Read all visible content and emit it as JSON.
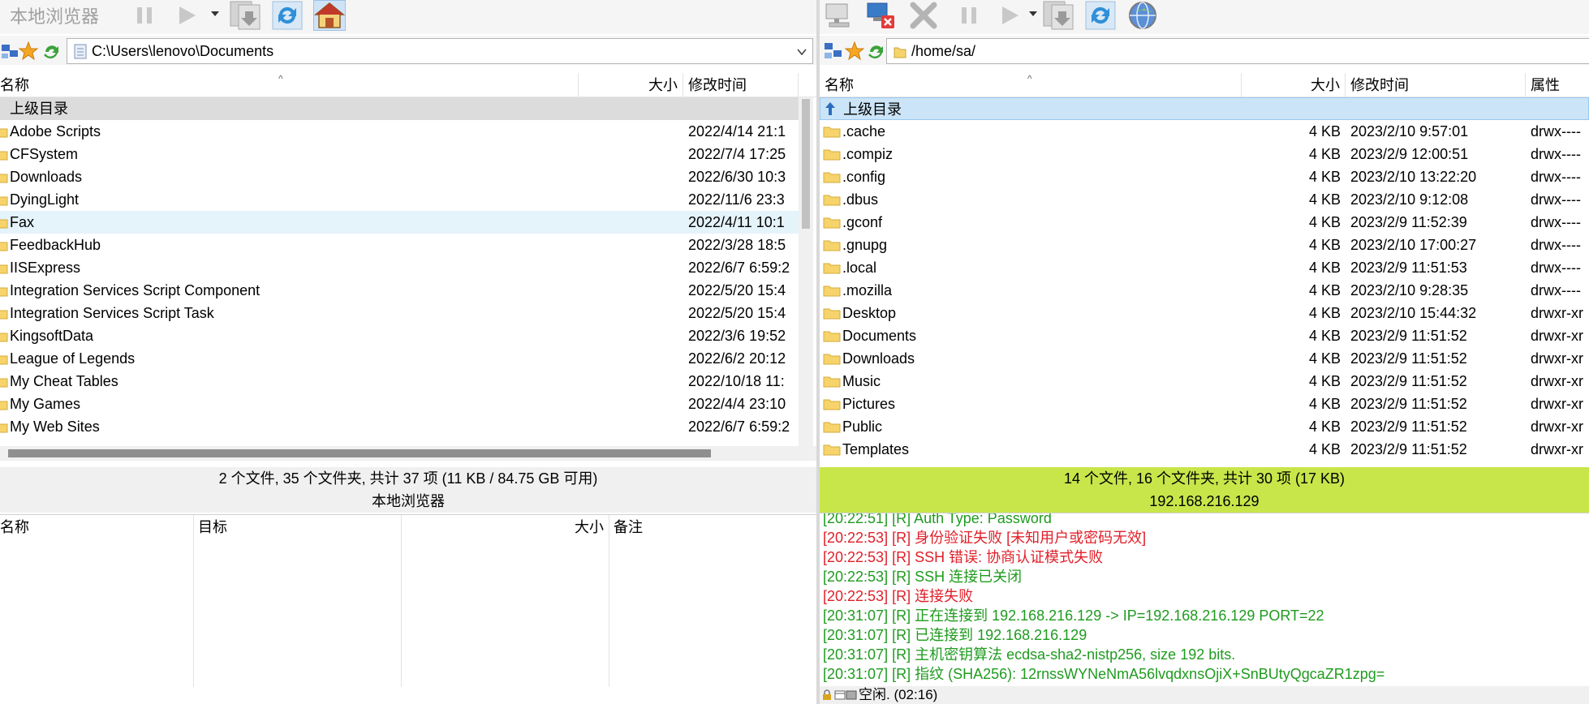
{
  "left": {
    "toolbar": {
      "title": "本地浏览器"
    },
    "address": {
      "path": "C:\\Users\\lenovo\\Documents"
    },
    "columns": {
      "name": "名称",
      "size": "大小",
      "modified": "修改时间"
    },
    "parent_row": {
      "name": "上级目录"
    },
    "rows": [
      {
        "name": "Adobe Scripts",
        "size": "",
        "modified": "2022/4/14 21:1"
      },
      {
        "name": "CFSystem",
        "size": "",
        "modified": "2022/7/4 17:25"
      },
      {
        "name": "Downloads",
        "size": "",
        "modified": "2022/6/30 10:3"
      },
      {
        "name": "DyingLight",
        "size": "",
        "modified": "2022/11/6 23:3"
      },
      {
        "name": "Fax",
        "size": "",
        "modified": "2022/4/11 10:1"
      },
      {
        "name": "FeedbackHub",
        "size": "",
        "modified": "2022/3/28 18:5"
      },
      {
        "name": "IISExpress",
        "size": "",
        "modified": "2022/6/7 6:59:2"
      },
      {
        "name": "Integration Services Script Component",
        "size": "",
        "modified": "2022/5/20 15:4"
      },
      {
        "name": "Integration Services Script Task",
        "size": "",
        "modified": "2022/5/20 15:4"
      },
      {
        "name": "KingsoftData",
        "size": "",
        "modified": "2022/3/6 19:52"
      },
      {
        "name": "League of Legends",
        "size": "",
        "modified": "2022/6/2 20:12"
      },
      {
        "name": "My Cheat Tables",
        "size": "",
        "modified": "2022/10/18 11:"
      },
      {
        "name": "My Games",
        "size": "",
        "modified": "2022/4/4 23:10"
      },
      {
        "name": "My Web Sites",
        "size": "",
        "modified": "2022/6/7 6:59:2"
      }
    ],
    "status": "2 个文件, 35 个文件夹, 共计 37 项 (11 KB / 84.75 GB 可用)",
    "substatus": "本地浏览器"
  },
  "queue": {
    "columns": {
      "name": "名称",
      "target": "目标",
      "size": "大小",
      "note": "备注"
    }
  },
  "right": {
    "address": {
      "path": "/home/sa/"
    },
    "columns": {
      "name": "名称",
      "size": "大小",
      "modified": "修改时间",
      "attrs": "属性"
    },
    "parent_row": {
      "name": "上级目录"
    },
    "rows": [
      {
        "name": ".cache",
        "size": "4 KB",
        "modified": "2023/2/10 9:57:01",
        "attrs": "drwx----"
      },
      {
        "name": ".compiz",
        "size": "4 KB",
        "modified": "2023/2/9 12:00:51",
        "attrs": "drwx----"
      },
      {
        "name": ".config",
        "size": "4 KB",
        "modified": "2023/2/10 13:22:20",
        "attrs": "drwx----"
      },
      {
        "name": ".dbus",
        "size": "4 KB",
        "modified": "2023/2/10 9:12:08",
        "attrs": "drwx----"
      },
      {
        "name": ".gconf",
        "size": "4 KB",
        "modified": "2023/2/9 11:52:39",
        "attrs": "drwx----"
      },
      {
        "name": ".gnupg",
        "size": "4 KB",
        "modified": "2023/2/10 17:00:27",
        "attrs": "drwx----"
      },
      {
        "name": ".local",
        "size": "4 KB",
        "modified": "2023/2/9 11:51:53",
        "attrs": "drwx----"
      },
      {
        "name": ".mozilla",
        "size": "4 KB",
        "modified": "2023/2/10 9:28:35",
        "attrs": "drwx----"
      },
      {
        "name": "Desktop",
        "size": "4 KB",
        "modified": "2023/2/10 15:44:32",
        "attrs": "drwxr-xr"
      },
      {
        "name": "Documents",
        "size": "4 KB",
        "modified": "2023/2/9 11:51:52",
        "attrs": "drwxr-xr"
      },
      {
        "name": "Downloads",
        "size": "4 KB",
        "modified": "2023/2/9 11:51:52",
        "attrs": "drwxr-xr"
      },
      {
        "name": "Music",
        "size": "4 KB",
        "modified": "2023/2/9 11:51:52",
        "attrs": "drwxr-xr"
      },
      {
        "name": "Pictures",
        "size": "4 KB",
        "modified": "2023/2/9 11:51:52",
        "attrs": "drwxr-xr"
      },
      {
        "name": "Public",
        "size": "4 KB",
        "modified": "2023/2/9 11:51:52",
        "attrs": "drwxr-xr"
      },
      {
        "name": "Templates",
        "size": "4 KB",
        "modified": "2023/2/9 11:51:52",
        "attrs": "drwxr-xr"
      }
    ],
    "status": "14 个文件, 16 个文件夹, 共计 30 项 (17 KB)",
    "substatus": "192.168.216.129"
  },
  "log": [
    {
      "text": "[20:22:51]  [R] Auth Type: Password",
      "color": "green"
    },
    {
      "text": "[20:22:53]  [R] 身份验证失败 [未知用户或密码无效]",
      "color": "red"
    },
    {
      "text": "[20:22:53]  [R] SSH 错误: 协商认证模式失败",
      "color": "red"
    },
    {
      "text": "[20:22:53]  [R] SSH 连接已关闭",
      "color": "green"
    },
    {
      "text": "[20:22:53]  [R] 连接失败",
      "color": "red"
    },
    {
      "text": "[20:31:07]  [R] 正在连接到 192.168.216.129 -> IP=192.168.216.129 PORT=22",
      "color": "green"
    },
    {
      "text": "[20:31:07]  [R] 已连接到 192.168.216.129",
      "color": "green"
    },
    {
      "text": "[20:31:07]  [R] 主机密钥算法 ecdsa-sha2-nistp256, size 192 bits.",
      "color": "green"
    },
    {
      "text": "[20:31:07]  [R] 指纹 (SHA256): 12rnssWYNeNmA56lvqdxnsOjiX+SnBUtyQgcaZR1zpg=",
      "color": "green"
    }
  ],
  "bottom_status": "空闲. (02:16)",
  "colors": {
    "status_green": "#c8e64a",
    "log_green": "#1f9b1f",
    "log_red": "#e0202a",
    "selection": "#cce4f7"
  },
  "icons": [
    "pause-icon",
    "play-icon",
    "download-icon",
    "refresh-icon",
    "home-icon",
    "computer-icon",
    "disconnect-icon",
    "stop-icon",
    "globe-icon",
    "bookmark-star-icon",
    "sync-icon",
    "folder-icon",
    "up-folder-icon"
  ]
}
